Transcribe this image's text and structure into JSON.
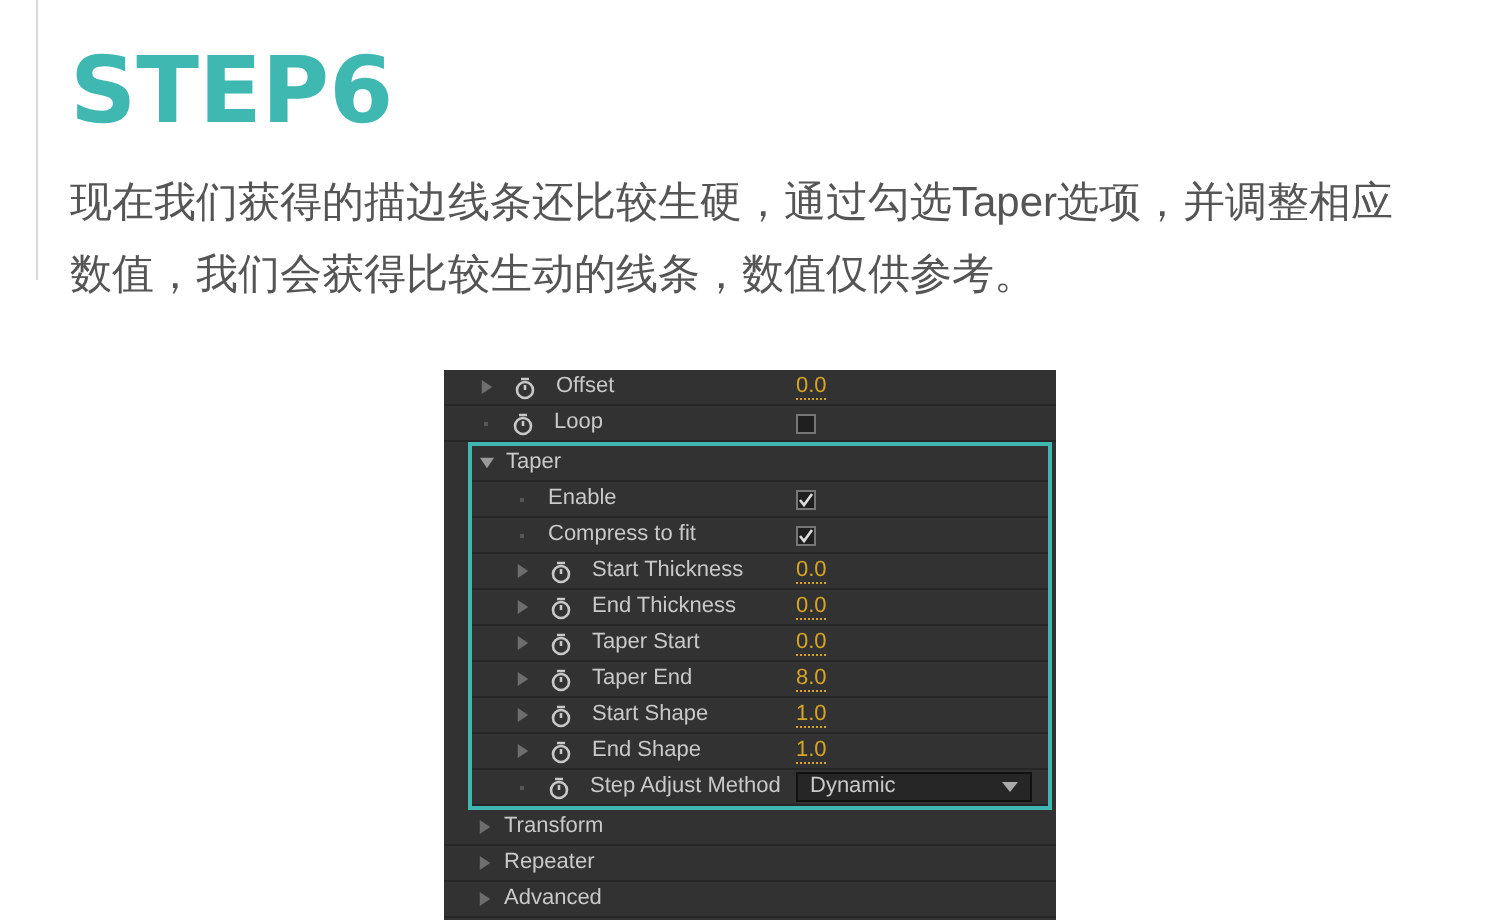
{
  "heading": "STEP6",
  "paragraph": "现在我们获得的描边线条还比较生硬，通过勾选Taper选项，并调整相应数值，我们会获得比较生动的线条，数值仅供参考。",
  "panel": {
    "rows": [
      {
        "kind": "value",
        "label": "Offset",
        "value": "0.0",
        "expandable": true,
        "stopwatch": true
      },
      {
        "kind": "checkbox",
        "label": "Loop",
        "checked": false,
        "expandable": false,
        "stopwatch": true
      },
      {
        "kind": "group",
        "label": "Taper",
        "expanded": true,
        "highlighted": true,
        "children": [
          {
            "kind": "checkbox",
            "label": "Enable",
            "checked": true,
            "expandable": false,
            "stopwatch": false
          },
          {
            "kind": "checkbox",
            "label": "Compress to fit",
            "checked": true,
            "expandable": false,
            "stopwatch": false
          },
          {
            "kind": "value",
            "label": "Start Thickness",
            "value": "0.0",
            "expandable": true,
            "stopwatch": true
          },
          {
            "kind": "value",
            "label": "End Thickness",
            "value": "0.0",
            "expandable": true,
            "stopwatch": true
          },
          {
            "kind": "value",
            "label": "Taper Start",
            "value": "0.0",
            "expandable": true,
            "stopwatch": true
          },
          {
            "kind": "value",
            "label": "Taper End",
            "value": "8.0",
            "expandable": true,
            "stopwatch": true
          },
          {
            "kind": "value",
            "label": "Start Shape",
            "value": "1.0",
            "expandable": true,
            "stopwatch": true
          },
          {
            "kind": "value",
            "label": "End Shape",
            "value": "1.0",
            "expandable": true,
            "stopwatch": true
          },
          {
            "kind": "dropdown",
            "label": "Step Adjust Method",
            "value": "Dynamic",
            "expandable": false,
            "stopwatch": true
          }
        ]
      },
      {
        "kind": "group",
        "label": "Transform",
        "expanded": false,
        "highlighted": false
      },
      {
        "kind": "group",
        "label": "Repeater",
        "expanded": false,
        "highlighted": false
      },
      {
        "kind": "group",
        "label": "Advanced",
        "expanded": false,
        "highlighted": false
      }
    ]
  }
}
